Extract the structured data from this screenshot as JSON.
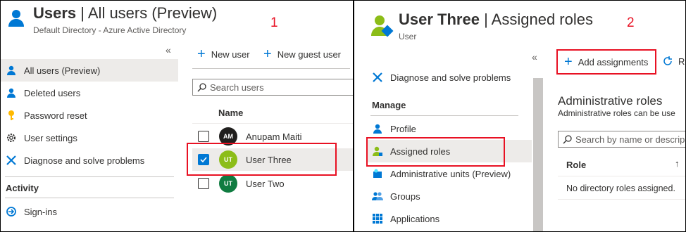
{
  "panel1": {
    "title_bold": "Users",
    "title_rest": " | All users (Preview)",
    "subtitle": "Default Directory - Azure Active Directory",
    "step": "1",
    "collapse": "«",
    "nav": [
      {
        "label": "All users (Preview)",
        "icon": "user-icon"
      },
      {
        "label": "Deleted users",
        "icon": "deleted-user-icon"
      },
      {
        "label": "Password reset",
        "icon": "key-icon"
      },
      {
        "label": "User settings",
        "icon": "gear-icon"
      },
      {
        "label": "Diagnose and solve problems",
        "icon": "wrench-icon"
      }
    ],
    "section_activity": "Activity",
    "signins_label": "Sign-ins",
    "new_user": "New user",
    "new_guest_user": "New guest user",
    "search_placeholder": "Search users",
    "col_name": "Name",
    "users": [
      {
        "initials": "AM",
        "name": "Anupam Maiti",
        "color": "#201f1e",
        "checked": false
      },
      {
        "initials": "UT",
        "name": "User Three",
        "color": "#8cbd18",
        "checked": true
      },
      {
        "initials": "UT",
        "name": "User Two",
        "color": "#107c41",
        "checked": false
      }
    ]
  },
  "panel2": {
    "title_bold": "User Three",
    "title_rest": " | Assigned roles",
    "subtitle": "User",
    "step": "2",
    "collapse": "«",
    "diagnose": "Diagnose and solve problems",
    "section_manage": "Manage",
    "nav": [
      {
        "label": "Profile",
        "icon": "profile-icon"
      },
      {
        "label": "Assigned roles",
        "icon": "assigned-roles-icon"
      },
      {
        "label": "Administrative units (Preview)",
        "icon": "admin-units-icon"
      },
      {
        "label": "Groups",
        "icon": "groups-icon"
      },
      {
        "label": "Applications",
        "icon": "applications-icon"
      }
    ],
    "add_assignments": "Add assignments",
    "refresh_partial": "R",
    "admin_roles_heading": "Administrative roles",
    "admin_roles_desc": "Administrative roles can be use",
    "search_placeholder": "Search by name or descrip",
    "col_role": "Role",
    "sort_arrow": "↑",
    "empty_text": "No directory roles assigned."
  },
  "colors": {
    "accent": "#0078d4",
    "highlight": "#e81123",
    "active_bg": "#edebe9"
  }
}
